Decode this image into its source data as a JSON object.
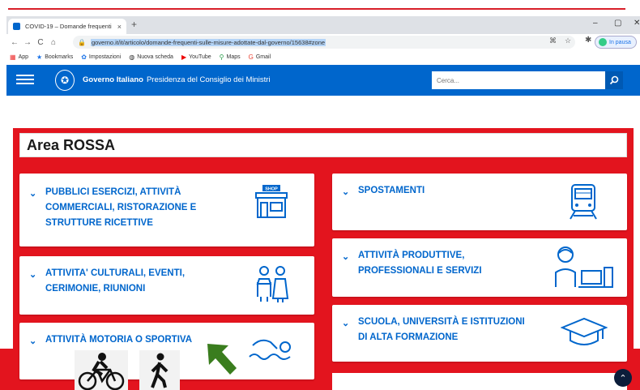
{
  "browser": {
    "tab_title": "COVID-19 – Domande frequenti",
    "tab_close": "×",
    "new_tab": "+",
    "url": "governo.it/it/articolo/domande-frequenti-sulle-misure-adottate-dal-governo/15638#zone",
    "profile_status": "In pausa",
    "window_controls": [
      "–",
      "▢",
      "✕"
    ]
  },
  "bookmarks": [
    {
      "label": "App",
      "icon": "apps-grid-icon"
    },
    {
      "label": "Bookmarks",
      "icon": "star-icon"
    },
    {
      "label": "Impostazioni",
      "icon": "gear-icon"
    },
    {
      "label": "Nuova scheda",
      "icon": "globe-icon"
    },
    {
      "label": "YouTube",
      "icon": "youtube-icon"
    },
    {
      "label": "Maps",
      "icon": "map-pin-icon"
    },
    {
      "label": "Gmail",
      "icon": "gmail-icon"
    }
  ],
  "header": {
    "brand_bold": "Governo Italiano",
    "brand_text": "Presidenza del Consiglio dei Ministri",
    "search_placeholder": "Cerca..."
  },
  "area": {
    "title": "Area ROSSA",
    "left_cards": [
      {
        "lines": [
          "PUBBLICI ESERCIZI, ATTIVITÀ",
          "COMMERCIALI, RISTORAZIONE E",
          "STRUTTURE RICETTIVE"
        ],
        "icon": "shop-icon"
      },
      {
        "lines": [
          "ATTIVITA' CULTURALI, EVENTI,",
          "CERIMONIE, RIUNIONI"
        ],
        "icon": "couple-icon"
      },
      {
        "lines": [
          "ATTIVITÀ MOTORIA O SPORTIVA"
        ],
        "icon": "swimmer-icon"
      }
    ],
    "right_cards": [
      {
        "lines": [
          "SPOSTAMENTI"
        ],
        "icon": "train-icon"
      },
      {
        "lines": [
          "ATTIVITÀ PRODUTTIVE,",
          "PROFESSIONALI E SERVIZI"
        ],
        "icon": "worker-computer-icon"
      },
      {
        "lines": [
          "SCUOLA, UNIVERSITÀ E ISTITUZIONI",
          "DI ALTA FORMAZIONE"
        ],
        "icon": "graduation-cap-icon"
      }
    ]
  },
  "colors": {
    "brand_blue": "#0066cc",
    "zone_red": "#e3141e"
  }
}
